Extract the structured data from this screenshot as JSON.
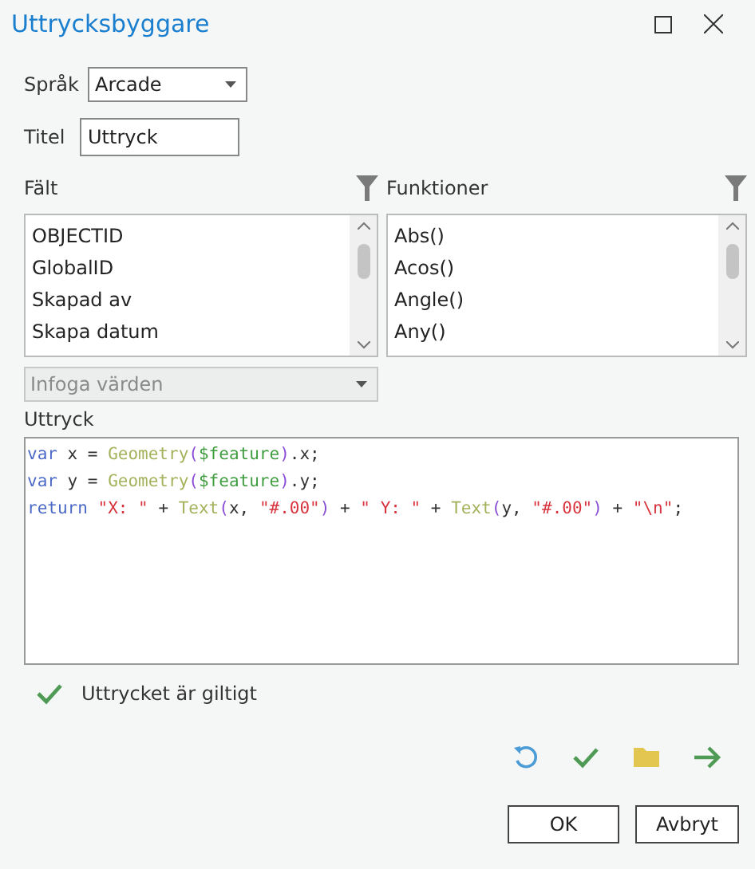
{
  "window": {
    "title": "Uttrycksbyggare"
  },
  "language": {
    "label": "Språk",
    "value": "Arcade"
  },
  "title_field": {
    "label": "Titel",
    "value": "Uttryck"
  },
  "fields": {
    "label": "Fält",
    "items": [
      "OBJECTID",
      "GlobalID",
      "Skapad av",
      "Skapa datum"
    ]
  },
  "functions": {
    "label": "Funktioner",
    "items": [
      "Abs()",
      "Acos()",
      "Angle()",
      "Any()"
    ]
  },
  "insert_values": {
    "value": "Infoga värden",
    "disabled": true
  },
  "expression": {
    "label": "Uttryck",
    "lines": [
      [
        {
          "text": "var",
          "kind": "keyword"
        },
        {
          "text": " x = ",
          "kind": "plain"
        },
        {
          "text": "Geometry",
          "kind": "function"
        },
        {
          "text": "(",
          "kind": "paren"
        },
        {
          "text": "$feature",
          "kind": "global"
        },
        {
          "text": ")",
          "kind": "paren"
        },
        {
          "text": ".x;",
          "kind": "plain"
        }
      ],
      [
        {
          "text": "var",
          "kind": "keyword"
        },
        {
          "text": " y = ",
          "kind": "plain"
        },
        {
          "text": "Geometry",
          "kind": "function"
        },
        {
          "text": "(",
          "kind": "paren"
        },
        {
          "text": "$feature",
          "kind": "global"
        },
        {
          "text": ")",
          "kind": "paren"
        },
        {
          "text": ".y;",
          "kind": "plain"
        }
      ],
      [
        {
          "text": "return",
          "kind": "keyword"
        },
        {
          "text": " \"X: \"",
          "kind": "string"
        },
        {
          "text": " + ",
          "kind": "plain"
        },
        {
          "text": "Text",
          "kind": "function"
        },
        {
          "text": "(",
          "kind": "paren"
        },
        {
          "text": "x, ",
          "kind": "plain"
        },
        {
          "text": "\"#.00\"",
          "kind": "string"
        },
        {
          "text": ")",
          "kind": "paren"
        },
        {
          "text": " + ",
          "kind": "plain"
        },
        {
          "text": "\" Y: \"",
          "kind": "string"
        },
        {
          "text": " + ",
          "kind": "plain"
        },
        {
          "text": "Text",
          "kind": "function"
        },
        {
          "text": "(",
          "kind": "paren"
        },
        {
          "text": "y, ",
          "kind": "plain"
        },
        {
          "text": "\"#.00\"",
          "kind": "string"
        },
        {
          "text": ")",
          "kind": "paren"
        },
        {
          "text": " + ",
          "kind": "plain"
        },
        {
          "text": "\"\\n\"",
          "kind": "string"
        },
        {
          "text": ";",
          "kind": "plain"
        }
      ]
    ]
  },
  "validation": {
    "message": "Uttrycket är giltigt",
    "valid": true
  },
  "buttons": [
    "OK",
    "Avbryt"
  ]
}
